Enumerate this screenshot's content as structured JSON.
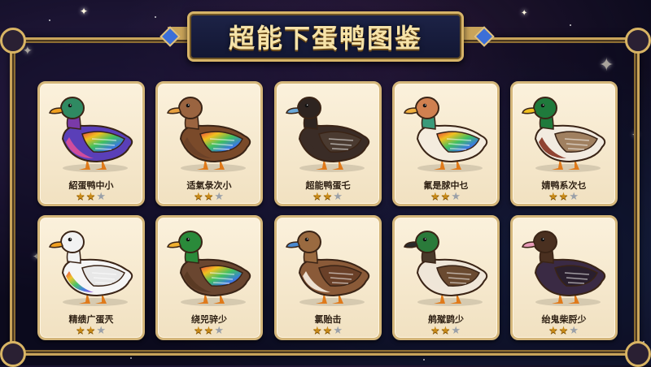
{
  "title": "超能下蛋鸭图鉴",
  "colors": {
    "gold": "#d7b468",
    "star_on": "#c88a18",
    "star_off": "#9aa0a8"
  },
  "ducks": [
    {
      "name": "紹蛋鸭中小",
      "stars": 2,
      "max_stars": 3,
      "head": "#2f8a62",
      "head2": "#7a3aa8",
      "beak": "#f0a020",
      "body": "#5a3fb8",
      "wing": "rainbow",
      "belly": "#d84e9a"
    },
    {
      "name": "适氣彔次小",
      "stars": 2,
      "max_stars": 3,
      "head": "#9a6440",
      "head2": "#9a6440",
      "beak": "#e6a040",
      "body": "#7a4a2a",
      "wing": "rainbow",
      "belly": "#6a4028"
    },
    {
      "name": "超能鸭蛋乇",
      "stars": 2,
      "max_stars": 3,
      "head": "#2e2420",
      "head2": "#2e2420",
      "beak": "#6aa8d8",
      "body": "#3a2c26",
      "wing": "#4a3a30",
      "belly": "#3a2c26"
    },
    {
      "name": "氟是脙中乜",
      "stars": 2,
      "max_stars": 3,
      "head": "#d08050",
      "head2": "#3a9a7a",
      "beak": "#f0b040",
      "body": "#f4ecde",
      "wing": "rainbow",
      "belly": "#f4ecde"
    },
    {
      "name": "婧鸭系次乜",
      "stars": 2,
      "max_stars": 3,
      "head": "#1f7a3c",
      "head2": "#1f7a3c",
      "beak": "#f0c020",
      "body": "#f2ebe0",
      "wing": "#a08060",
      "belly": "#8a3a28"
    },
    {
      "name": "精缋广蛋兲",
      "stars": 2,
      "max_stars": 3,
      "head": "#f2f2f2",
      "head2": "#f2f2f2",
      "beak": "#f0a020",
      "body": "#f5f5f5",
      "wing": "#e8e8e8",
      "belly": "rainbow"
    },
    {
      "name": "绕兕骍少",
      "stars": 2,
      "max_stars": 3,
      "head": "#2a8a3a",
      "head2": "#2a8a3a",
      "beak": "#f0b030",
      "body": "#6a4630",
      "wing": "rainbow",
      "belly": "#5a3a24"
    },
    {
      "name": "氯贻击",
      "stars": 2,
      "max_stars": 3,
      "head": "#9a6a40",
      "head2": "#9a6a40",
      "beak": "#4a8ad0",
      "body": "#8a5a38",
      "wing": "#6a4028",
      "belly": "#f2e8d8"
    },
    {
      "name": "鸼殧鹍少",
      "stars": 2,
      "max_stars": 3,
      "head": "#2a7a3a",
      "head2": "#4a3a2a",
      "beak": "#2a2a2a",
      "body": "#efe6d8",
      "wing": "#6a4a30",
      "belly": "#efe6d8"
    },
    {
      "name": "绐鬼柴脟少",
      "stars": 2,
      "max_stars": 3,
      "head": "#4a3020",
      "head2": "#4a3020",
      "beak": "#e89ab8",
      "body": "#3a2a44",
      "wing": "#2a1f2e",
      "belly": "#3a2a44"
    }
  ]
}
